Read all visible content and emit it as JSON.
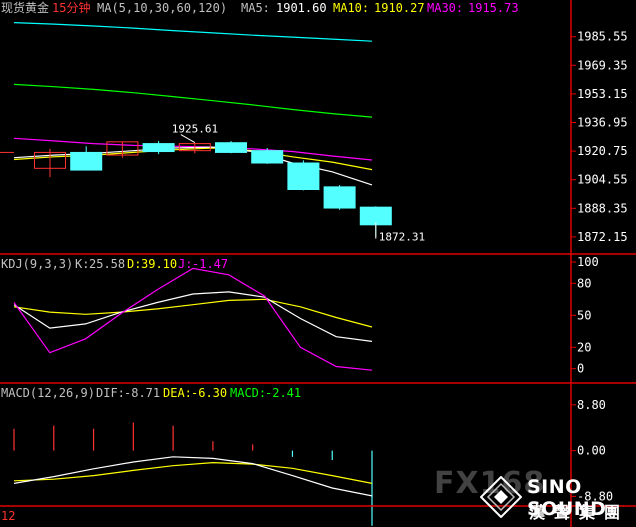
{
  "chart_data": {
    "type": "candlestick",
    "title": "现货黄金",
    "period": "15分钟",
    "colors": {
      "background": "#000000",
      "up": "#ff3232",
      "down": "#54ffff",
      "ma5": "#ffffff",
      "ma10": "#ffff00",
      "ma30": "#ff00ff",
      "ma60": "#00ff00",
      "ma120": "#00ffff",
      "separator": "#e00000",
      "text": "#c0c0c0",
      "axis_text": "#ffffff"
    },
    "price_panel": {
      "header_ma": "MA(5,10,30,60,120)",
      "ma5_label": "MA5:",
      "ma5_value": "1901.60",
      "ma10_label": "MA10:",
      "ma10_value": "1910.27",
      "ma30_label": "MA30:",
      "ma30_value": "1915.73",
      "ylim": [
        1867.0,
        1995.0
      ],
      "y_ticks": [
        "1985.55",
        "1969.35",
        "1953.15",
        "1936.95",
        "1920.75",
        "1904.55",
        "1888.35",
        "1872.15"
      ],
      "high_annotation": "1925.61",
      "low_annotation": "1872.31",
      "candles": [
        {
          "o": 1911.0,
          "h": 1922.0,
          "l": 1906.0,
          "c": 1920.0
        },
        {
          "o": 1920.0,
          "h": 1923.5,
          "l": 1910.0,
          "c": 1910.0
        },
        {
          "o": 1918.5,
          "h": 1926.0,
          "l": 1917.0,
          "c": 1926.0
        },
        {
          "o": 1925.0,
          "h": 1926.5,
          "l": 1919.0,
          "c": 1920.5
        },
        {
          "o": 1921.0,
          "h": 1925.61,
          "l": 1919.5,
          "c": 1925.0
        },
        {
          "o": 1925.5,
          "h": 1926.5,
          "l": 1919.5,
          "c": 1920.0
        },
        {
          "o": 1921.0,
          "h": 1922.5,
          "l": 1913.5,
          "c": 1914.0
        },
        {
          "o": 1914.0,
          "h": 1915.5,
          "l": 1898.5,
          "c": 1899.0
        },
        {
          "o": 1900.5,
          "h": 1901.5,
          "l": 1887.5,
          "c": 1888.5
        },
        {
          "o": 1889.0,
          "h": 1889.5,
          "l": 1872.31,
          "c": 1879.0
        }
      ],
      "ma5": [
        1917.0,
        1918.5,
        1919.5,
        1921.0,
        1922.5,
        1923.0,
        1920.5,
        1914.0,
        1909.0,
        1901.6
      ],
      "ma10": [
        1916.0,
        1917.5,
        1918.5,
        1920.0,
        1921.5,
        1922.5,
        1921.0,
        1917.5,
        1914.5,
        1910.27
      ],
      "ma30": [
        1928.0,
        1926.5,
        1925.0,
        1924.0,
        1923.5,
        1923.0,
        1922.0,
        1920.5,
        1918.0,
        1915.73
      ],
      "ma60": [
        1958.5,
        1957.2,
        1955.7,
        1953.8,
        1951.6,
        1949.3,
        1946.9,
        1944.3,
        1942.0,
        1940.0
      ],
      "ma120": [
        1993.5,
        1992.7,
        1991.6,
        1990.4,
        1989.0,
        1987.7,
        1986.4,
        1985.3,
        1984.2,
        1983.0
      ]
    },
    "kdj_panel": {
      "label": "KDJ(9,3,3)",
      "k_label": "K:",
      "k_value": "25.58",
      "d_label": "D:",
      "d_value": "39.10",
      "j_label": "J:",
      "j_value": "-1.47",
      "ylim": [
        -5,
        100
      ],
      "y_ticks": [
        "100",
        "80",
        "50",
        "20",
        "0"
      ],
      "k": [
        60,
        38,
        42,
        53,
        62,
        70,
        72,
        67,
        47,
        30,
        25.58
      ],
      "d": [
        58,
        53,
        51,
        53,
        56,
        60,
        64,
        65,
        58,
        48,
        39.1
      ],
      "j": [
        62,
        15,
        28,
        52,
        74,
        94,
        88,
        68,
        20,
        2,
        -1.47
      ]
    },
    "macd_panel": {
      "label": "MACD(12,26,9)",
      "dif_label": "DIF:",
      "dif_value": "-8.71",
      "dea_label": "DEA:",
      "dea_value": "-6.30",
      "macd_label": "MACD:",
      "macd_value": "-2.41",
      "ylim": [
        -9.5,
        10.5
      ],
      "y_ticks": [
        "8.80",
        "0.00",
        "-8.80"
      ],
      "dif": [
        -6.3,
        -5.0,
        -3.5,
        -2.2,
        -1.2,
        -1.5,
        -2.5,
        -4.8,
        -7.2,
        -8.71
      ],
      "dea": [
        -5.8,
        -5.5,
        -4.8,
        -3.8,
        -2.9,
        -2.3,
        -2.6,
        -3.4,
        -4.8,
        -6.3
      ],
      "bars": [
        0.7,
        0.8,
        0.7,
        0.9,
        0.8,
        0.3,
        0.2,
        -0.2,
        -0.3,
        -2.41
      ],
      "bar_x": [
        0.7,
        38,
        70,
        108,
        142,
        192,
        226,
        265,
        302,
        340,
        372
      ]
    },
    "bottom_label": "12"
  },
  "watermark": {
    "fx_text": "FX168",
    "brand": "SINO SOUND",
    "brand_cn": "漢聲集團"
  }
}
